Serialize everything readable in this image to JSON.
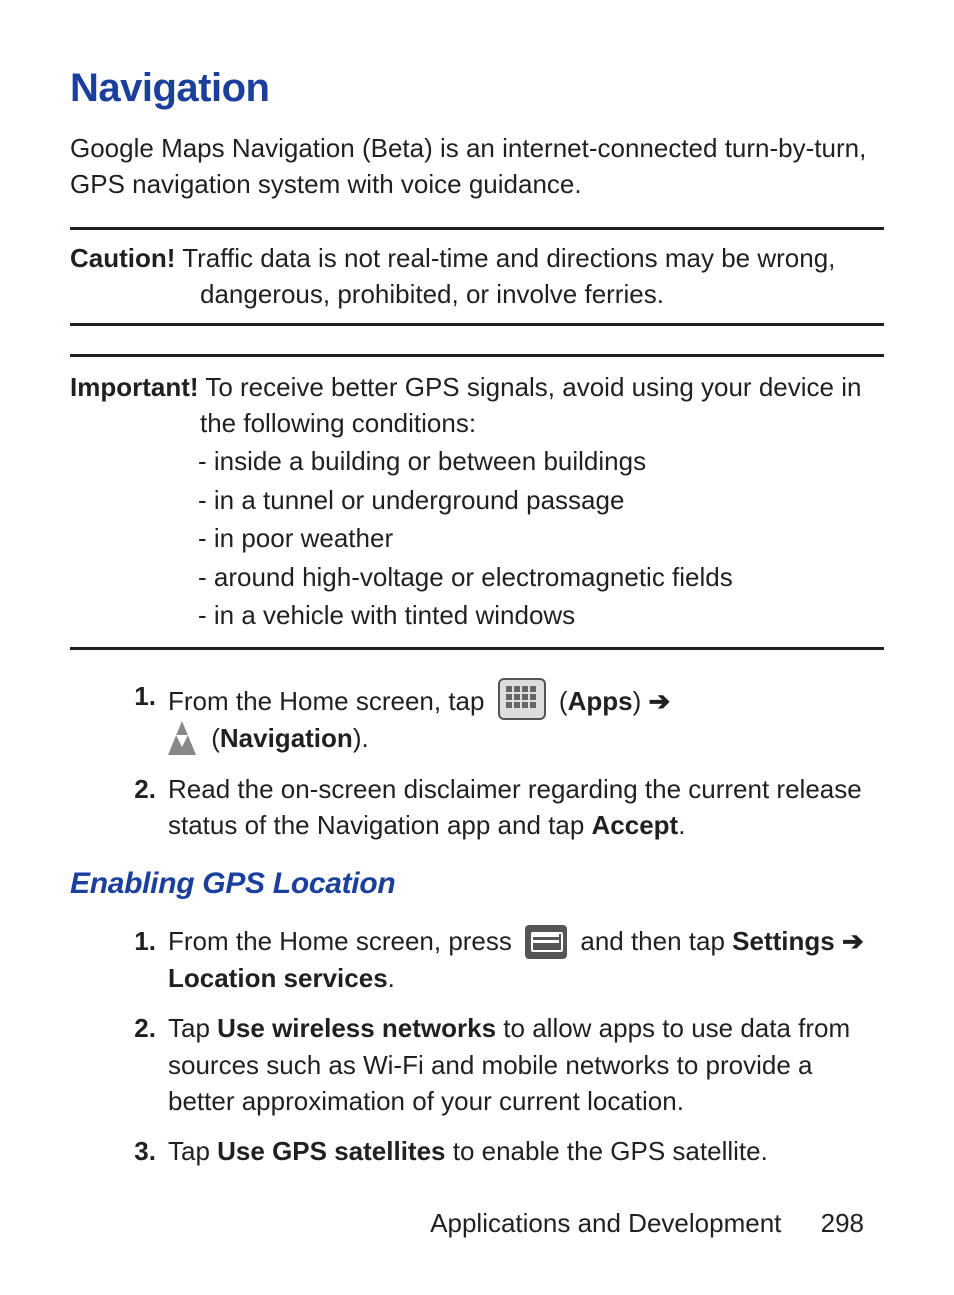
{
  "heading": "Navigation",
  "intro": "Google Maps Navigation (Beta) is an internet-connected turn-by-turn, GPS navigation system with voice guidance.",
  "caution": {
    "label": "Caution!",
    "text": "Traffic data is not real-time and directions may be wrong, dangerous, prohibited, or involve ferries."
  },
  "important": {
    "label": "Important!",
    "lead": "To receive better GPS signals, avoid using your device in the following conditions:",
    "conditions": [
      "- inside a building or between buildings",
      "- in a tunnel or underground passage",
      "- in poor weather",
      "- around high-voltage or electromagnetic fields",
      "- in a vehicle with tinted windows"
    ]
  },
  "steps_main": {
    "s1_a": "From the Home screen, tap ",
    "s1_apps": "Apps",
    "s1_arrow": "➔",
    "s1_nav": "Navigation",
    "s2_a": "Read the on-screen disclaimer regarding the current release status of the Navigation app and tap ",
    "s2_accept": "Accept",
    "s2_b": "."
  },
  "subheading": "Enabling GPS Location",
  "steps_gps": {
    "s1_a": "From the Home screen, press ",
    "s1_b": " and then tap ",
    "s1_settings": "Settings",
    "s1_arrow": "➔",
    "s1_loc": "Location services",
    "s1_c": ".",
    "s2_a": "Tap ",
    "s2_bold": "Use wireless networks",
    "s2_b": " to allow apps to use data from sources such as Wi-Fi and mobile networks to provide a better approximation of your current location.",
    "s3_a": "Tap ",
    "s3_bold": "Use GPS satellites",
    "s3_b": " to enable the GPS satellite."
  },
  "footer": {
    "section": "Applications and Development",
    "page": "298"
  }
}
